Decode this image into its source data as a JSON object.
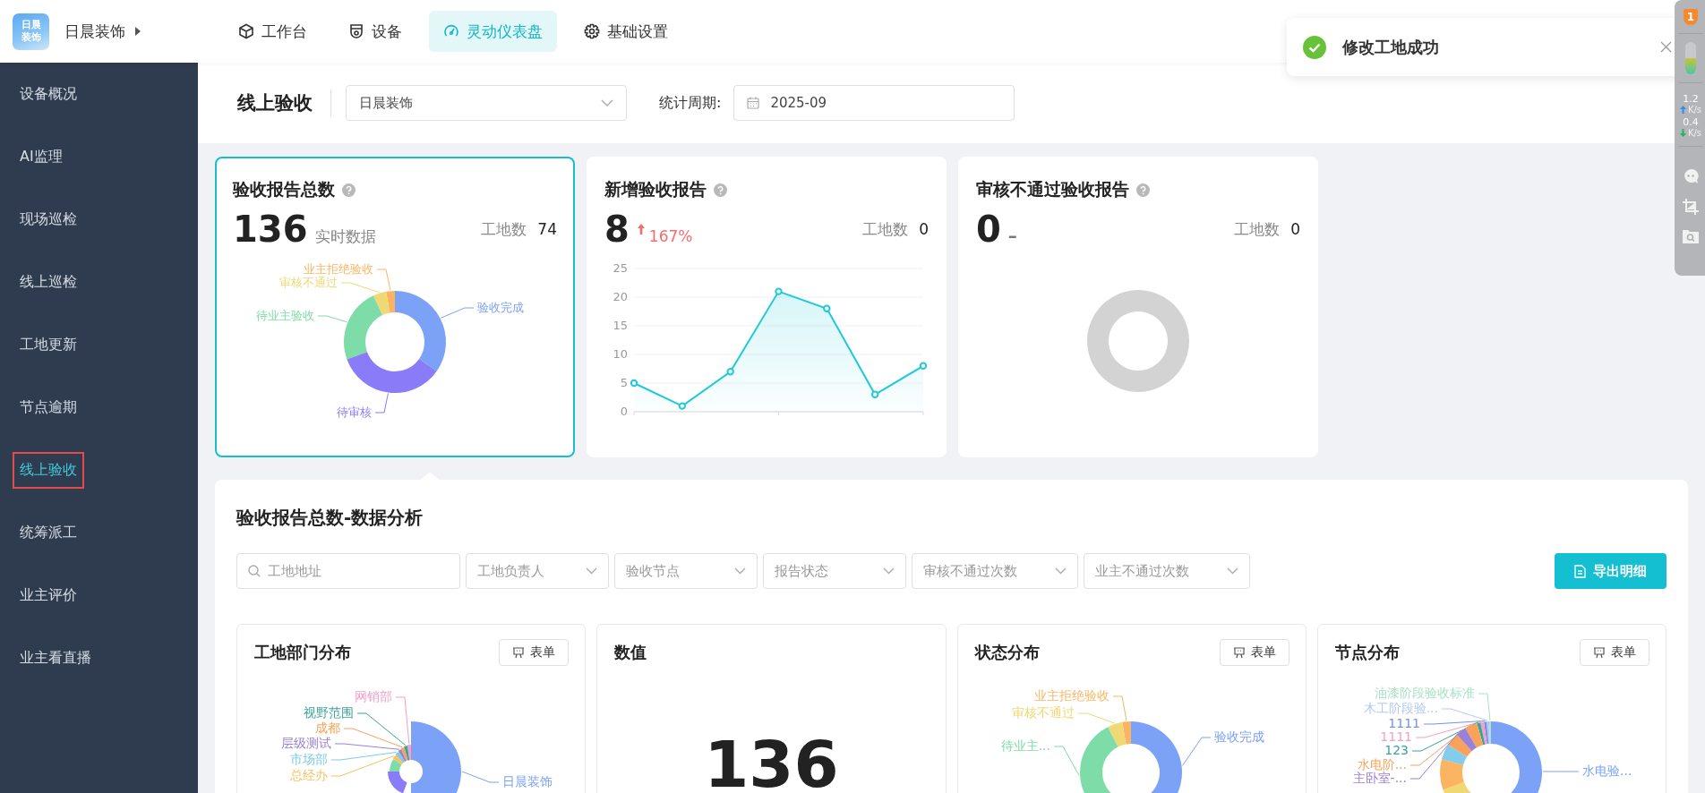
{
  "app": {
    "logo_lines": [
      "日晨",
      "装饰"
    ],
    "brand": "日晨装饰"
  },
  "nav": [
    {
      "label": "工作台",
      "selected": false
    },
    {
      "label": "设备",
      "selected": false
    },
    {
      "label": "灵动仪表盘",
      "selected": true
    },
    {
      "label": "基础设置",
      "selected": false
    }
  ],
  "toast": {
    "message": "修改工地成功"
  },
  "side_widget": {
    "badge": "1",
    "meter": {
      "level": 0.5
    },
    "upload": "1.2",
    "upload_unit": "K/s",
    "download": "0.4",
    "download_unit": "K/s"
  },
  "sidebar": {
    "items": [
      {
        "label": "设备概况",
        "selected": false
      },
      {
        "label": "AI监理",
        "selected": false
      },
      {
        "label": "现场巡检",
        "selected": false
      },
      {
        "label": "线上巡检",
        "selected": false
      },
      {
        "label": "工地更新",
        "selected": false
      },
      {
        "label": "节点逾期",
        "selected": false
      },
      {
        "label": "线上验收",
        "selected": true
      },
      {
        "label": "统筹派工",
        "selected": false
      },
      {
        "label": "业主评价",
        "selected": false
      },
      {
        "label": "业主看直播",
        "selected": false
      }
    ]
  },
  "header": {
    "title": "线上验收",
    "company_select": {
      "value": "日晨装饰"
    },
    "period_label": "统计周期:",
    "period_field": {
      "value": "2025-09"
    }
  },
  "stat_cards": [
    {
      "kind": "donut",
      "title": "验收报告总数",
      "value": "136",
      "note": "实时数据",
      "site_label": "工地数",
      "site_count": "74",
      "selected": true,
      "labels": [
        {
          "label": "业主拒绝验收",
          "color": "#fbb562"
        },
        {
          "label": "审核不通过",
          "color": "#f0d874"
        },
        {
          "label": "待业主验收",
          "color": "#7ddca8"
        },
        {
          "label": "验收完成",
          "color": "#7ba2f7"
        },
        {
          "label": "待审核",
          "color": "#8a7cf8"
        }
      ]
    },
    {
      "kind": "line",
      "title": "新增验收报告",
      "value": "8",
      "change": "167%",
      "site_label": "工地数",
      "site_count": "0",
      "selected": false,
      "chart_data": {
        "type": "area",
        "values": [
          5,
          1,
          7,
          21,
          18,
          3,
          8
        ],
        "ylim": [
          0,
          25
        ],
        "yticks": [
          0,
          5,
          10,
          15,
          20,
          25
        ],
        "grid": true
      }
    },
    {
      "kind": "empty",
      "title": "审核不通过验收报告",
      "value": "0",
      "note": "–",
      "site_label": "工地数",
      "site_count": "0",
      "selected": false
    }
  ],
  "analysis": {
    "title": "验收报告总数-数据分析",
    "filters": [
      {
        "kind": "search",
        "placeholder": "工地地址"
      },
      {
        "kind": "select",
        "placeholder": "工地负责人"
      },
      {
        "kind": "select",
        "placeholder": "验收节点"
      },
      {
        "kind": "select",
        "placeholder": "报告状态"
      },
      {
        "kind": "select",
        "placeholder": "审核不通过次数"
      },
      {
        "kind": "select",
        "placeholder": "业主不通过次数"
      }
    ],
    "export_button": "导出明细",
    "panels": [
      {
        "kind": "donut",
        "title": "工地部门分布",
        "button": "表单",
        "labels": [
          {
            "label": "网销部",
            "color": "#f59ec6"
          },
          {
            "label": "视野范围",
            "color": "#3aa39a"
          },
          {
            "label": "成都",
            "color": "#f8a25a"
          },
          {
            "label": "层级测试",
            "color": "#9b80d8"
          },
          {
            "label": "市场部",
            "color": "#7ccbe9"
          },
          {
            "label": "总经办",
            "color": "#f8c060"
          },
          {
            "label": "日晨装饰",
            "color": "#7ba2f7"
          }
        ]
      },
      {
        "kind": "number",
        "title": "数值",
        "value": "136"
      },
      {
        "kind": "donut",
        "title": "状态分布",
        "button": "表单",
        "labels": [
          {
            "label": "业主拒绝验收",
            "color": "#fbb562"
          },
          {
            "label": "审核不通过",
            "color": "#f0d874"
          },
          {
            "label": "待业主...",
            "color": "#7ddca8"
          },
          {
            "label": "验收完成",
            "color": "#7ba2f7"
          }
        ]
      },
      {
        "kind": "donut",
        "title": "节点分布",
        "button": "表单",
        "labels": [
          {
            "label": "油漆阶段验收标准",
            "color": "#a9e2c6"
          },
          {
            "label": "木工阶段验...",
            "color": "#b3c8f5"
          },
          {
            "label": "1111",
            "color": "#6f93ef"
          },
          {
            "label": "1111",
            "color": "#f59ec6"
          },
          {
            "label": "123",
            "color": "#3aa39a"
          },
          {
            "label": "水电阶...",
            "color": "#f8a25a"
          },
          {
            "label": "主卧室-...",
            "color": "#9b80d8"
          },
          {
            "label": "水电验...",
            "color": "#7ba2f7"
          }
        ]
      }
    ]
  }
}
